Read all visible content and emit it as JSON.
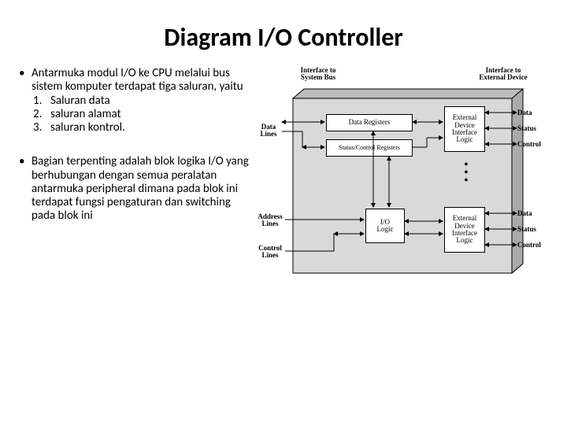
{
  "title": "Diagram I/O Controller",
  "bullets": [
    {
      "text": "Antarmuka modul I/O ke CPU melalui bus sistem komputer terdapat tiga saluran, yaitu",
      "items": [
        "Saluran data",
        "saluran alamat",
        "saluran kontrol."
      ]
    },
    {
      "text": "Bagian terpenting adalah blok logika I/O yang berhubungan dengan semua peralatan antarmuka peripheral dimana pada blok ini terdapat fungsi pengaturan dan switching pada blok ini"
    }
  ],
  "diagram": {
    "top_left_label": "Interface to\nSystem Bus",
    "top_right_label": "Interface to\nExternal Device",
    "left_labels": {
      "data": "Data\nLines",
      "address": "Address\nLines",
      "control": "Control\nLines"
    },
    "center_boxes": {
      "data_reg": "Data Registers",
      "status_reg": "Status/Control Registers",
      "io_logic": "I/O\nLogic"
    },
    "right_boxes": {
      "upper": "External\nDevice\nInterface\nLogic",
      "lower": "External\nDevice\nInterface\nLogic"
    },
    "right_labels": {
      "data": "Data",
      "status": "Status",
      "control": "Control"
    },
    "dots": "⋮"
  }
}
